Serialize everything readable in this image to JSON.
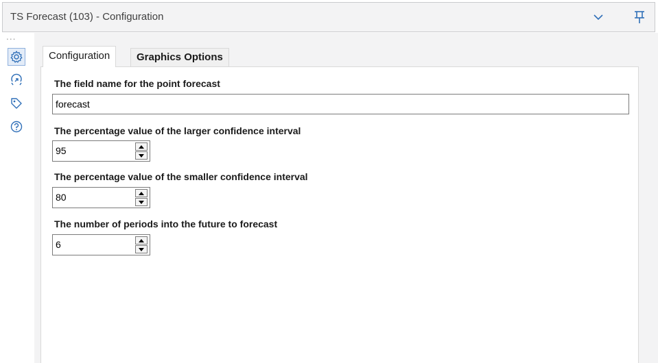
{
  "window": {
    "title": "TS Forecast (103) - Configuration"
  },
  "sidebar": {
    "overflow_glyph": "...",
    "items": [
      {
        "name": "configuration",
        "icon": "gear-icon",
        "active": true
      },
      {
        "name": "annotation",
        "icon": "annotation-arrow-icon",
        "active": false
      },
      {
        "name": "meta-info",
        "icon": "tag-icon",
        "active": false
      },
      {
        "name": "help",
        "icon": "help-circle-icon",
        "active": false
      }
    ]
  },
  "tabs": [
    {
      "label": "Configuration",
      "active": true
    },
    {
      "label": "Graphics Options",
      "active": false
    }
  ],
  "form": {
    "point_forecast": {
      "label": "The field name for the point forecast",
      "value": "forecast"
    },
    "larger_ci": {
      "label": "The percentage value of the larger confidence interval",
      "value": "95"
    },
    "smaller_ci": {
      "label": "The percentage value of the smaller confidence interval",
      "value": "80"
    },
    "periods": {
      "label": "The number of periods into the future to forecast",
      "value": "6"
    }
  },
  "colors": {
    "titlebar_bg": "#f3f3f4",
    "panel_border": "#d9d9d9",
    "icon_blue": "#2f6fb8",
    "active_icon_bg": "#e3ecf8"
  }
}
